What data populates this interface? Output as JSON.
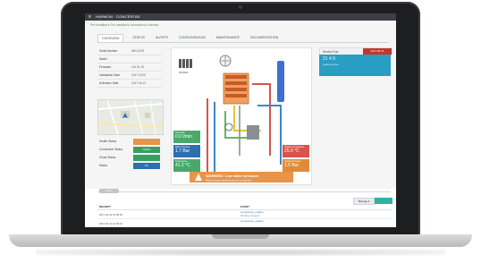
{
  "app": {
    "title": "HARMON · CONCERTAS"
  },
  "breadcrumb": "Pre-Installed ▸ Pro-installed ▸ Innovation ▸ Harmon",
  "tabs": [
    {
      "label": "OVERVIEW",
      "active": true
    },
    {
      "label": "STATUS",
      "active": false
    },
    {
      "label": "ALERTS",
      "active": false
    },
    {
      "label": "CONFIGURATION",
      "active": false
    },
    {
      "label": "MAINTENANCE",
      "active": false
    },
    {
      "label": "DOCUMENTATION",
      "active": false
    }
  ],
  "device_info": [
    {
      "key": "Serial Number",
      "value": "WH12478"
    },
    {
      "key": "Model",
      "value": ""
    },
    {
      "key": "Firmware",
      "value": "v31.01.15"
    },
    {
      "key": "Installation Date",
      "value": "2017.03.06"
    },
    {
      "key": "Activation Date",
      "value": "2017.04.12"
    }
  ],
  "statuses": [
    {
      "key": "Health Status",
      "value": "",
      "color": "#e8944a"
    },
    {
      "key": "Connection Status",
      "value": "Online",
      "color": "#3a9e62"
    },
    {
      "key": "Cloud Status",
      "value": "",
      "color": "#3a9e62"
    },
    {
      "key": "Status",
      "value": "On",
      "color": "#2e6fb0"
    }
  ],
  "diagram": {
    "label_water": "WATER",
    "gauges": [
      {
        "label": "Flow Rate",
        "value": "0.0 l/min",
        "color": "#4aa86b"
      },
      {
        "label": "Water Pressure",
        "value": "1.7 Bar",
        "color": "#2e6fb0"
      },
      {
        "label": "Temperature",
        "value": "41.2 °C",
        "color": "#4aa86b"
      },
      {
        "label": "Heating Temperature",
        "value": "25.0 °C",
        "color": "#d9534f"
      },
      {
        "label": "Heating Pressure",
        "value": "1.5 Bar",
        "color": "#e08a3c"
      }
    ],
    "warning_title": "WARNING: Low water pressure",
    "warning_sub": "Water pressure detected too low to continue"
  },
  "right_panel": {
    "label": "Service Due",
    "badge": "2017.05.31",
    "big": "21 4 0",
    "small": "Heating active"
  },
  "bottom": {
    "pill": "History",
    "manage_label": "Manage ▾",
    "columns": [
      "RECEIPT",
      "EVENT"
    ],
    "rows": [
      {
        "date": "2017-04-12 12:08:24",
        "event": "pump/pump_rotation",
        "detail": "Rotating stopped"
      },
      {
        "date": "2017-04-12 12:09:24",
        "event": "pump/pump_rotation",
        "detail": ""
      }
    ]
  },
  "colors": {
    "accent": "#2bb3a3",
    "warning": "#e8944a",
    "danger": "#c0392b",
    "info": "#2a9dc4"
  }
}
